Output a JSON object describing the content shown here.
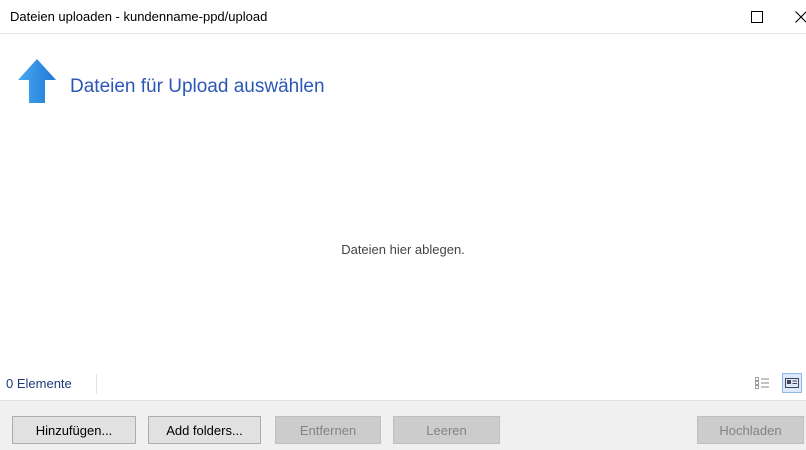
{
  "window": {
    "title": "Dateien uploaden - kundenname-ppd/upload"
  },
  "header": {
    "title": "Dateien für Upload auswählen",
    "icon": "upload-arrow-icon",
    "accent_color": "#2b58b6"
  },
  "dropzone": {
    "hint": "Dateien hier ablegen."
  },
  "status": {
    "count_label": "0 Elemente"
  },
  "buttons": {
    "add": "Hinzufügen...",
    "add_folders": "Add folders...",
    "remove": "Entfernen",
    "clear": "Leeren",
    "upload": "Hochladen"
  }
}
